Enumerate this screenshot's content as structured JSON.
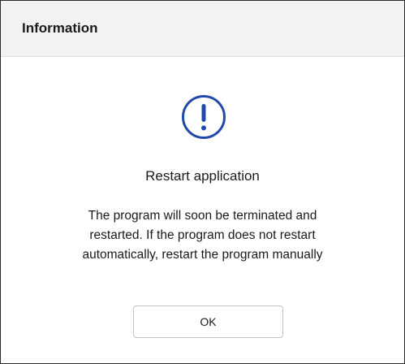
{
  "dialog": {
    "title": "Information",
    "icon": "exclamation-circle-icon",
    "accent_color": "#1f4aa8",
    "heading": "Restart application",
    "message_lines": [
      "The program will soon be terminated and",
      "restarted. If the program does not restart",
      "automatically, restart the program manually"
    ],
    "ok_label": "OK"
  }
}
